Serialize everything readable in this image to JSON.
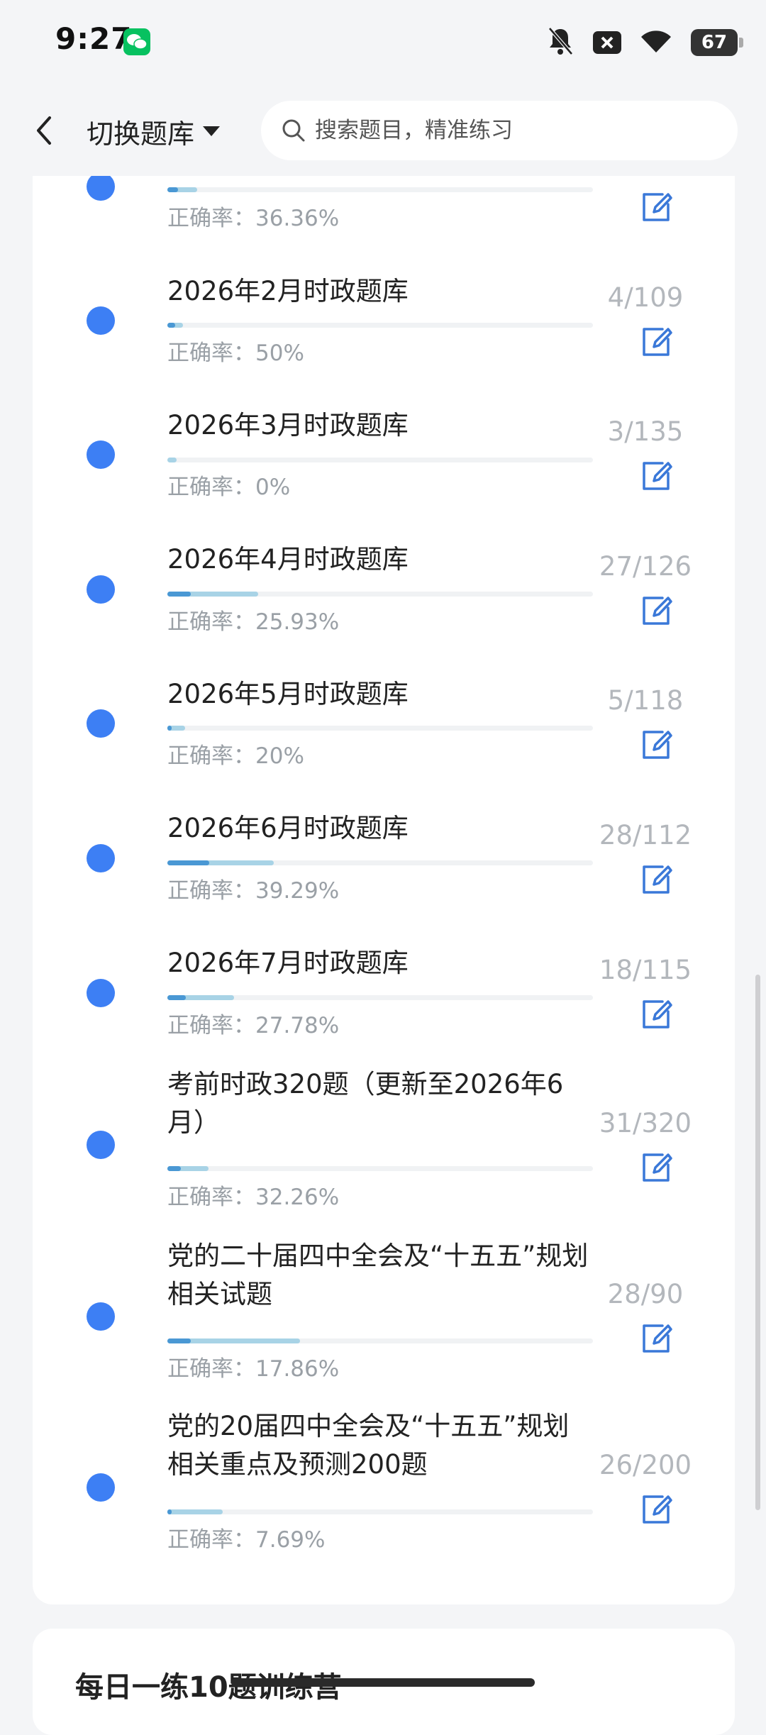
{
  "status": {
    "time": "9:27",
    "battery": "67"
  },
  "header": {
    "switch_label": "切换题库",
    "search_placeholder": "搜索题目，精准练习"
  },
  "accuracy_prefix": "正确率：",
  "items": [
    {
      "title": "",
      "count": "",
      "accuracy": "36.36%",
      "progress": 0.07,
      "accuracy_ratio": 0.36
    },
    {
      "title": "2026年2月时政题库",
      "count": "4/109",
      "accuracy": "50%",
      "progress": 0.037,
      "accuracy_ratio": 0.5
    },
    {
      "title": "2026年3月时政题库",
      "count": "3/135",
      "accuracy": "0%",
      "progress": 0.022,
      "accuracy_ratio": 0.0
    },
    {
      "title": "2026年4月时政题库",
      "count": "27/126",
      "accuracy": "25.93%",
      "progress": 0.214,
      "accuracy_ratio": 0.2593
    },
    {
      "title": "2026年5月时政题库",
      "count": "5/118",
      "accuracy": "20%",
      "progress": 0.042,
      "accuracy_ratio": 0.2
    },
    {
      "title": "2026年6月时政题库",
      "count": "28/112",
      "accuracy": "39.29%",
      "progress": 0.25,
      "accuracy_ratio": 0.3929
    },
    {
      "title": "2026年7月时政题库",
      "count": "18/115",
      "accuracy": "27.78%",
      "progress": 0.157,
      "accuracy_ratio": 0.2778
    },
    {
      "title": "考前时政320题（更新至2026年6月）",
      "count": "31/320",
      "accuracy": "32.26%",
      "progress": 0.097,
      "accuracy_ratio": 0.3226
    },
    {
      "title": "党的二十届四中全会及“十五五”规划相关试题",
      "count": "28/90",
      "accuracy": "17.86%",
      "progress": 0.311,
      "accuracy_ratio": 0.1786
    },
    {
      "title": "党的20届四中全会及“十五五”规划相关重点及预测200题",
      "count": "26/200",
      "accuracy": "7.69%",
      "progress": 0.13,
      "accuracy_ratio": 0.0769
    }
  ],
  "next_section_title": "每日一练10题训练营"
}
